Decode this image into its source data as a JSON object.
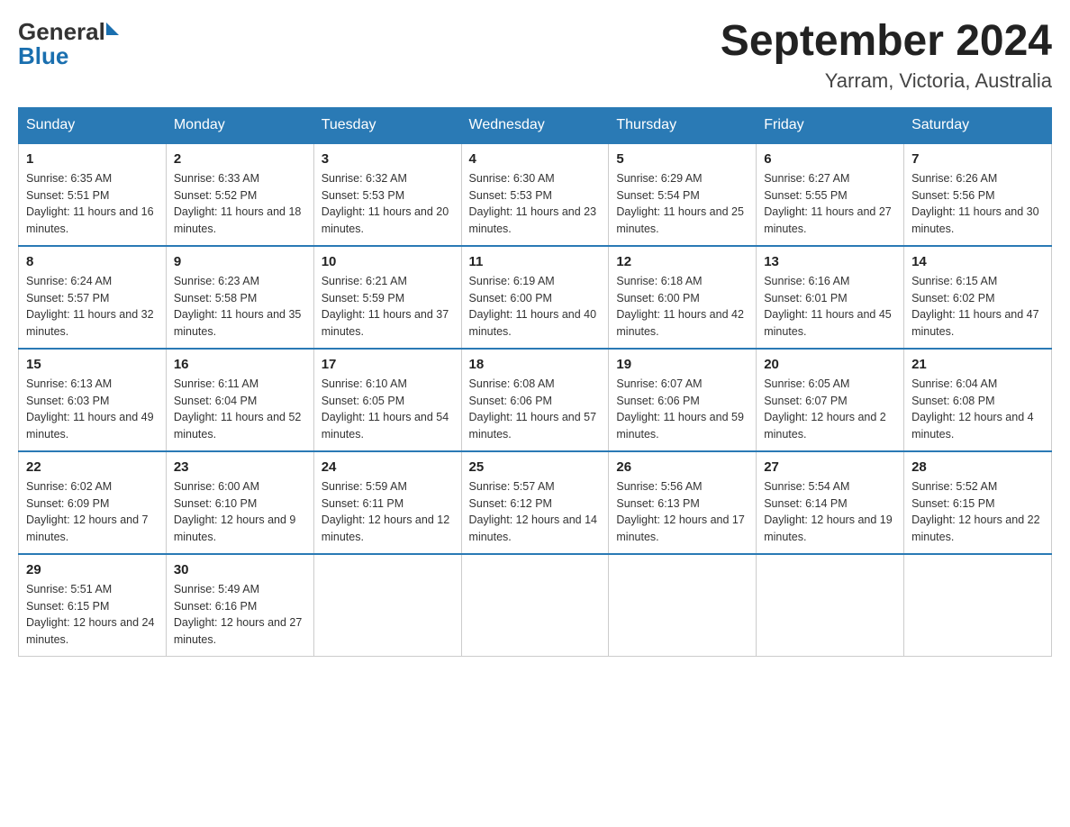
{
  "header": {
    "logo_general": "General",
    "logo_blue": "Blue",
    "month_year": "September 2024",
    "location": "Yarram, Victoria, Australia"
  },
  "days_of_week": [
    "Sunday",
    "Monday",
    "Tuesday",
    "Wednesday",
    "Thursday",
    "Friday",
    "Saturday"
  ],
  "weeks": [
    [
      {
        "day": "1",
        "sunrise": "6:35 AM",
        "sunset": "5:51 PM",
        "daylight": "11 hours and 16 minutes."
      },
      {
        "day": "2",
        "sunrise": "6:33 AM",
        "sunset": "5:52 PM",
        "daylight": "11 hours and 18 minutes."
      },
      {
        "day": "3",
        "sunrise": "6:32 AM",
        "sunset": "5:53 PM",
        "daylight": "11 hours and 20 minutes."
      },
      {
        "day": "4",
        "sunrise": "6:30 AM",
        "sunset": "5:53 PM",
        "daylight": "11 hours and 23 minutes."
      },
      {
        "day": "5",
        "sunrise": "6:29 AM",
        "sunset": "5:54 PM",
        "daylight": "11 hours and 25 minutes."
      },
      {
        "day": "6",
        "sunrise": "6:27 AM",
        "sunset": "5:55 PM",
        "daylight": "11 hours and 27 minutes."
      },
      {
        "day": "7",
        "sunrise": "6:26 AM",
        "sunset": "5:56 PM",
        "daylight": "11 hours and 30 minutes."
      }
    ],
    [
      {
        "day": "8",
        "sunrise": "6:24 AM",
        "sunset": "5:57 PM",
        "daylight": "11 hours and 32 minutes."
      },
      {
        "day": "9",
        "sunrise": "6:23 AM",
        "sunset": "5:58 PM",
        "daylight": "11 hours and 35 minutes."
      },
      {
        "day": "10",
        "sunrise": "6:21 AM",
        "sunset": "5:59 PM",
        "daylight": "11 hours and 37 minutes."
      },
      {
        "day": "11",
        "sunrise": "6:19 AM",
        "sunset": "6:00 PM",
        "daylight": "11 hours and 40 minutes."
      },
      {
        "day": "12",
        "sunrise": "6:18 AM",
        "sunset": "6:00 PM",
        "daylight": "11 hours and 42 minutes."
      },
      {
        "day": "13",
        "sunrise": "6:16 AM",
        "sunset": "6:01 PM",
        "daylight": "11 hours and 45 minutes."
      },
      {
        "day": "14",
        "sunrise": "6:15 AM",
        "sunset": "6:02 PM",
        "daylight": "11 hours and 47 minutes."
      }
    ],
    [
      {
        "day": "15",
        "sunrise": "6:13 AM",
        "sunset": "6:03 PM",
        "daylight": "11 hours and 49 minutes."
      },
      {
        "day": "16",
        "sunrise": "6:11 AM",
        "sunset": "6:04 PM",
        "daylight": "11 hours and 52 minutes."
      },
      {
        "day": "17",
        "sunrise": "6:10 AM",
        "sunset": "6:05 PM",
        "daylight": "11 hours and 54 minutes."
      },
      {
        "day": "18",
        "sunrise": "6:08 AM",
        "sunset": "6:06 PM",
        "daylight": "11 hours and 57 minutes."
      },
      {
        "day": "19",
        "sunrise": "6:07 AM",
        "sunset": "6:06 PM",
        "daylight": "11 hours and 59 minutes."
      },
      {
        "day": "20",
        "sunrise": "6:05 AM",
        "sunset": "6:07 PM",
        "daylight": "12 hours and 2 minutes."
      },
      {
        "day": "21",
        "sunrise": "6:04 AM",
        "sunset": "6:08 PM",
        "daylight": "12 hours and 4 minutes."
      }
    ],
    [
      {
        "day": "22",
        "sunrise": "6:02 AM",
        "sunset": "6:09 PM",
        "daylight": "12 hours and 7 minutes."
      },
      {
        "day": "23",
        "sunrise": "6:00 AM",
        "sunset": "6:10 PM",
        "daylight": "12 hours and 9 minutes."
      },
      {
        "day": "24",
        "sunrise": "5:59 AM",
        "sunset": "6:11 PM",
        "daylight": "12 hours and 12 minutes."
      },
      {
        "day": "25",
        "sunrise": "5:57 AM",
        "sunset": "6:12 PM",
        "daylight": "12 hours and 14 minutes."
      },
      {
        "day": "26",
        "sunrise": "5:56 AM",
        "sunset": "6:13 PM",
        "daylight": "12 hours and 17 minutes."
      },
      {
        "day": "27",
        "sunrise": "5:54 AM",
        "sunset": "6:14 PM",
        "daylight": "12 hours and 19 minutes."
      },
      {
        "day": "28",
        "sunrise": "5:52 AM",
        "sunset": "6:15 PM",
        "daylight": "12 hours and 22 minutes."
      }
    ],
    [
      {
        "day": "29",
        "sunrise": "5:51 AM",
        "sunset": "6:15 PM",
        "daylight": "12 hours and 24 minutes."
      },
      {
        "day": "30",
        "sunrise": "5:49 AM",
        "sunset": "6:16 PM",
        "daylight": "12 hours and 27 minutes."
      },
      null,
      null,
      null,
      null,
      null
    ]
  ],
  "labels": {
    "sunrise": "Sunrise:",
    "sunset": "Sunset:",
    "daylight": "Daylight:"
  }
}
